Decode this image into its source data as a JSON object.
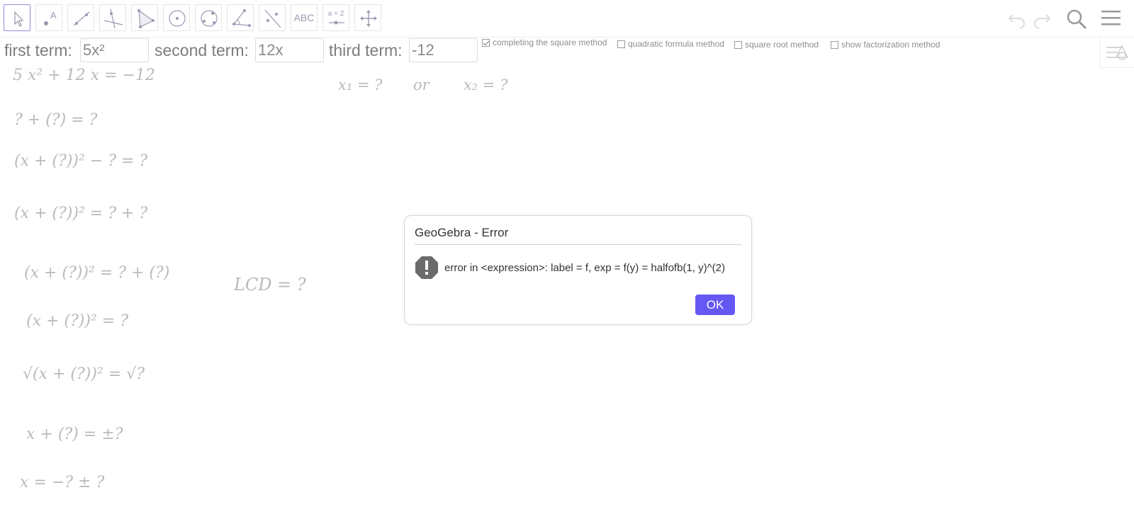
{
  "toolbar": {
    "tools": [
      {
        "name": "move-tool",
        "label": ""
      },
      {
        "name": "point-tool",
        "label": "A"
      },
      {
        "name": "line-tool",
        "label": ""
      },
      {
        "name": "perpendicular-line-tool",
        "label": ""
      },
      {
        "name": "polygon-tool",
        "label": ""
      },
      {
        "name": "circle-center-point-tool",
        "label": ""
      },
      {
        "name": "circle-three-points-tool",
        "label": ""
      },
      {
        "name": "angle-tool",
        "label": ""
      },
      {
        "name": "reflect-tool",
        "label": ""
      },
      {
        "name": "text-tool",
        "label": "ABC"
      },
      {
        "name": "slider-tool",
        "label": "a = 2"
      },
      {
        "name": "move-graphics-view-tool",
        "label": ""
      }
    ],
    "right_icons": [
      "undo-icon",
      "redo-icon",
      "search-icon",
      "menu-icon"
    ]
  },
  "inputs": {
    "first_label": "first term:",
    "first_value": "5x²",
    "second_label": "second term:",
    "second_value": "12x",
    "third_label": "third term:",
    "third_value": "-12"
  },
  "checkboxes": [
    {
      "label": "completing the square method",
      "checked": true
    },
    {
      "label": "quadratic formula method",
      "checked": false
    },
    {
      "label": "square root method",
      "checked": false
    },
    {
      "label": "show factorization method",
      "checked": false
    }
  ],
  "equations": {
    "e1": "5 x² + 12 x = −12",
    "roots_x1": "x₁ = ?",
    "roots_or": "or",
    "roots_x2": "x₂ = ?",
    "e2": "? + (?) = ?",
    "e3": "(x + (?))² − ? = ?",
    "e4": "(x + (?))² = ? + ?",
    "e5": "(x + (?))² = ? + (?)",
    "lcd": "LCD = ?",
    "e6": "(x + (?))² = ?",
    "e7": "√(x + (?))² = √?",
    "e8": "x + (?) = ±?",
    "e9": "x = −? ± ?"
  },
  "dialog": {
    "title": "GeoGebra - Error",
    "message": "error in <expression>: label = f, exp = f(y) = halfofb(1, y)^(2)",
    "ok_label": "OK",
    "icon": "error-icon"
  },
  "colors": {
    "ok_button": "#6557f2",
    "tool_icon": "#9a9ab0",
    "equation_text": "#b9b9b9"
  }
}
